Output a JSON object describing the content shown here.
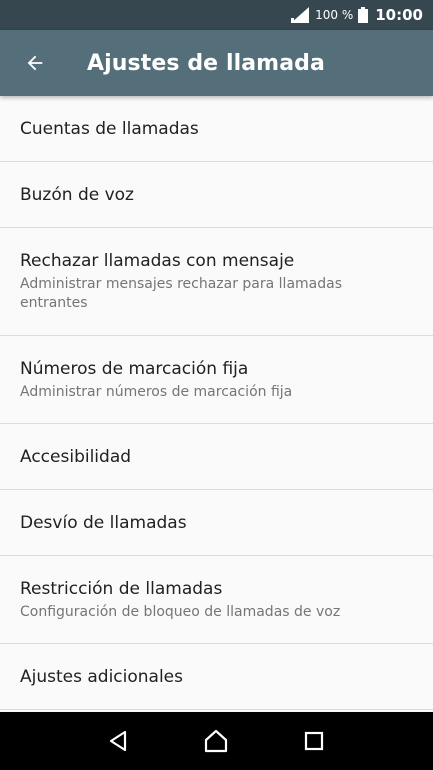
{
  "status_bar": {
    "battery_percent": "100 %",
    "time": "10:00",
    "icons": [
      "signal-icon",
      "battery-icon"
    ]
  },
  "app_bar": {
    "title": "Ajustes de llamada",
    "back_icon": "arrow-back-icon",
    "background": "#546e7a"
  },
  "items": [
    {
      "title": "Cuentas de llamadas"
    },
    {
      "title": "Buzón de voz"
    },
    {
      "title": "Rechazar llamadas con mensaje",
      "subtitle": "Administrar mensajes rechazar para llamadas entrantes"
    },
    {
      "title": "Números de marcación fija",
      "subtitle": "Administrar números de marcación fija"
    },
    {
      "title": "Accesibilidad"
    },
    {
      "title": "Desvío de llamadas"
    },
    {
      "title": "Restricción de llamadas",
      "subtitle": "Configuración de bloqueo de llamadas de voz"
    },
    {
      "title": "Ajustes adicionales"
    }
  ],
  "nav_bar": {
    "icons": [
      "back-triangle-icon",
      "home-icon",
      "recents-square-icon"
    ]
  }
}
